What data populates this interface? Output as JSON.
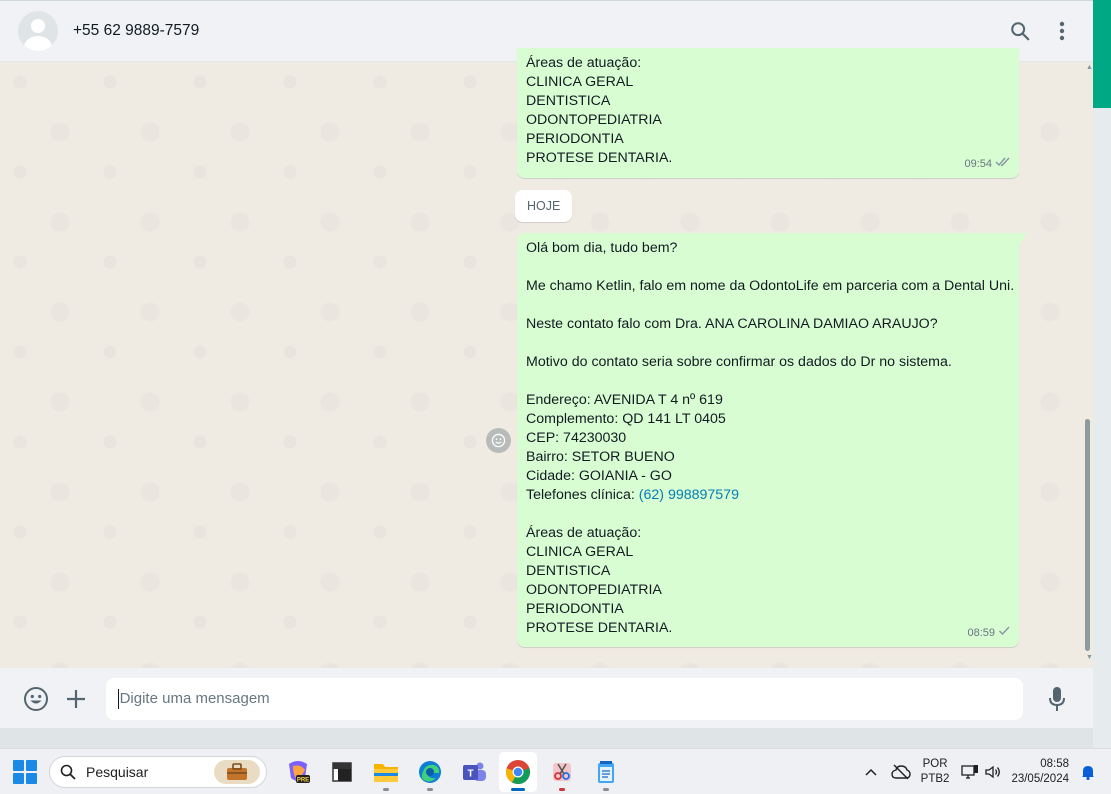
{
  "header": {
    "contact_name": "+55 62 9889-7579",
    "icons": [
      "search-icon",
      "menu-dots-icon"
    ]
  },
  "messages": {
    "top": {
      "lines": [
        "Áreas de atuação:",
        "CLINICA GERAL",
        "DENTISTICA",
        "ODONTOPEDIATRIA",
        "PERIODONTIA",
        "PROTESE DENTARIA."
      ],
      "time": "09:54",
      "status": "read-double-check"
    },
    "day_divider": "HOJE",
    "main": {
      "l1": "Olá bom dia, tudo bem?",
      "l2": "Me chamo Ketlin, falo em nome da OdontoLife em parceria com a Dental Uni.",
      "l3": "Neste contato falo com Dra. ANA CAROLINA DAMIAO ARAUJO?",
      "l4": "Motivo do contato seria sobre confirmar os dados do Dr no sistema.",
      "endereco": "Endereço: AVENIDA T 4 nº 619",
      "complemento": "Complemento: QD 141 LT 0405",
      "cep": "CEP: 74230030",
      "bairro": "Bairro: SETOR BUENO",
      "cidade": "Cidade: GOIANIA - GO",
      "telefone_label": "Telefones clínica: ",
      "telefone_link": "(62) 998897579",
      "areas_title": "Áreas de atuação:",
      "areas": [
        "CLINICA GERAL",
        "DENTISTICA",
        "ODONTOPEDIATRIA",
        "PERIODONTIA",
        "PROTESE DENTARIA."
      ],
      "time": "08:59",
      "status": "sent-single-check"
    }
  },
  "composer": {
    "placeholder": "Digite uma mensagem",
    "icons": [
      "emoji-icon",
      "plus-icon",
      "mic-icon"
    ]
  },
  "taskbar": {
    "search_label": "Pesquisar",
    "apps": [
      "copilot-icon",
      "terminal-icon",
      "file-explorer-icon",
      "edge-icon",
      "teams-icon",
      "chrome-icon",
      "snipping-tool-icon",
      "notepad-icon"
    ],
    "lang_line1": "POR",
    "lang_line2": "PTB2",
    "time": "08:58",
    "date": "23/05/2024"
  },
  "colors": {
    "bubble_out": "#d9fdd3",
    "chat_bg": "#efeae2",
    "link": "#027eb5",
    "accent": "#00a884"
  }
}
